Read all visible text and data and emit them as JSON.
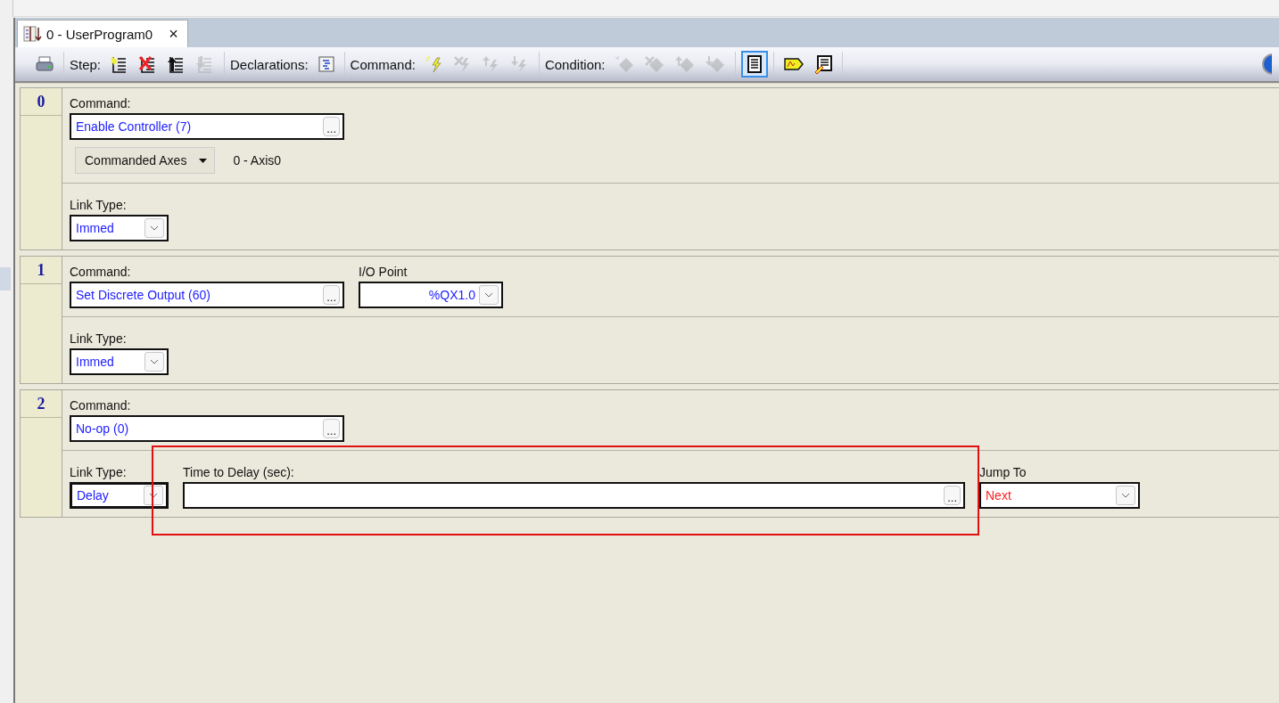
{
  "tab": {
    "title": "0 - UserProgram0",
    "close": "×",
    "selected": true
  },
  "toolbar": {
    "groups": [
      {
        "buttons": [
          {
            "disabled": false,
            "selected": false
          }
        ]
      },
      {
        "label": "Step:",
        "buttons": [
          {
            "disabled": false,
            "selected": false
          },
          {
            "disabled": false,
            "selected": false
          },
          {
            "disabled": false,
            "selected": false
          },
          {
            "disabled": true,
            "selected": false
          }
        ]
      },
      {
        "label": "Declarations:",
        "buttons": [
          {
            "disabled": false,
            "selected": false
          }
        ]
      },
      {
        "label": "Command:",
        "buttons": [
          {
            "disabled": false,
            "selected": false
          },
          {
            "disabled": true,
            "selected": false
          },
          {
            "disabled": true,
            "selected": false
          },
          {
            "disabled": true,
            "selected": false
          }
        ]
      },
      {
        "label": "Condition:",
        "buttons": [
          {
            "disabled": true,
            "selected": false
          },
          {
            "disabled": true,
            "selected": false
          },
          {
            "disabled": true,
            "selected": false
          },
          {
            "disabled": true,
            "selected": false
          }
        ]
      },
      {
        "buttons": [
          {
            "disabled": false,
            "selected": true
          }
        ]
      },
      {
        "buttons": [
          {
            "disabled": false,
            "selected": false
          },
          {
            "disabled": false,
            "selected": false
          }
        ]
      }
    ]
  },
  "steps": [
    {
      "number": "0",
      "sections": [
        {
          "rows": [
            {
              "fields": [
                {
                  "kind": "command",
                  "label": "Command:",
                  "value": "Enable Controller (7)",
                  "button": "...",
                  "invalid": false
                }
              ]
            },
            {
              "fields": [
                {
                  "kind": "axes",
                  "button": "Commanded Axes",
                  "text": "0 - Axis0"
                }
              ]
            }
          ]
        },
        {
          "rows": [
            {
              "fields": [
                {
                  "kind": "link",
                  "label": "Link Type:",
                  "value": "Immed",
                  "invalid": false,
                  "focused": false
                }
              ]
            }
          ]
        }
      ]
    },
    {
      "number": "1",
      "sections": [
        {
          "rows": [
            {
              "fields": [
                {
                  "kind": "command",
                  "label": "Command:",
                  "value": "Set Discrete Output (60)",
                  "button": "...",
                  "invalid": false
                },
                {
                  "kind": "io",
                  "label": "I/O Point",
                  "value": "%QX1.0",
                  "invalid": false
                }
              ]
            }
          ]
        },
        {
          "rows": [
            {
              "fields": [
                {
                  "kind": "link",
                  "label": "Link Type:",
                  "value": "Immed",
                  "invalid": false,
                  "focused": false
                }
              ]
            }
          ]
        }
      ]
    },
    {
      "number": "2",
      "sections": [
        {
          "rows": [
            {
              "fields": [
                {
                  "kind": "command",
                  "label": "Command:",
                  "value": "No-op (0)",
                  "button": "...",
                  "invalid": false
                }
              ]
            }
          ]
        },
        {
          "rows": [
            {
              "fields": [
                {
                  "kind": "link",
                  "label": "Link Type:",
                  "value": "Delay",
                  "invalid": false,
                  "focused": true
                },
                {
                  "kind": "delay",
                  "label": "Time to Delay (sec):",
                  "button": "..."
                },
                {
                  "kind": "jump",
                  "label": "Jump To",
                  "value": "Next",
                  "invalid": true
                }
              ]
            }
          ]
        }
      ]
    }
  ],
  "highlight_box": true
}
